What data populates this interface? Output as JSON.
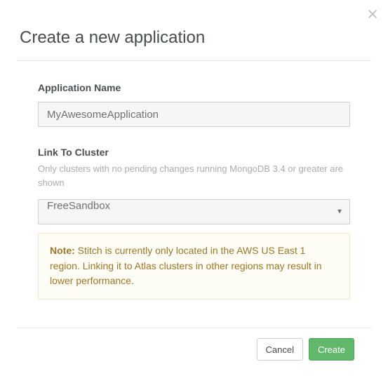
{
  "dialog": {
    "title": "Create a new application"
  },
  "form": {
    "app_name": {
      "label": "Application Name",
      "value": "MyAwesomeApplication"
    },
    "cluster": {
      "label": "Link To Cluster",
      "help": "Only clusters with no pending changes running MongoDB 3.4 or greater are shown",
      "selected": "FreeSandbox"
    },
    "note": {
      "label": "Note:",
      "text": " Stitch is currently only located in the AWS US East 1 region. Linking it to Atlas clusters in other regions may result in lower performance."
    }
  },
  "footer": {
    "cancel": "Cancel",
    "create": "Create"
  }
}
